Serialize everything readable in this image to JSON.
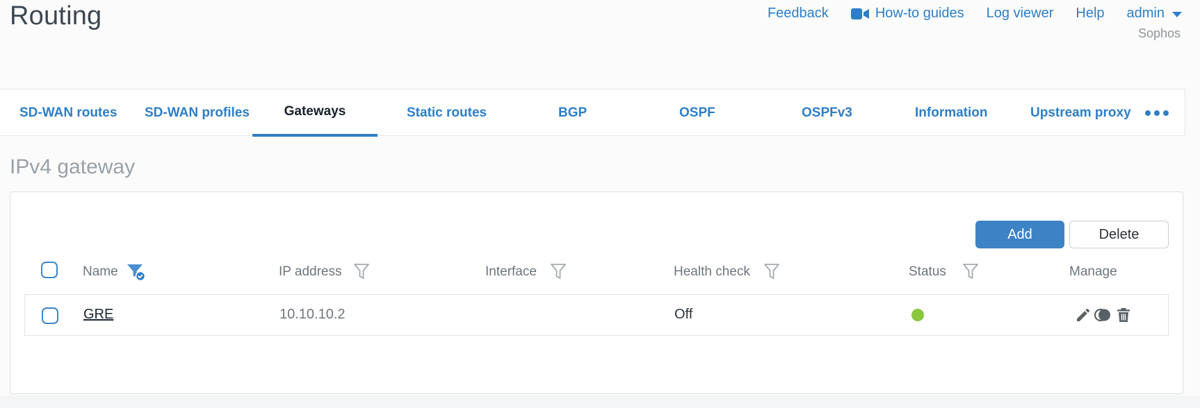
{
  "app": {
    "title": "Routing",
    "brand": "Sophos"
  },
  "header_nav": {
    "feedback": "Feedback",
    "how_to_guides": "How-to guides",
    "log_viewer": "Log viewer",
    "help": "Help",
    "user": "admin"
  },
  "tabs": [
    {
      "label": "SD-WAN routes",
      "active": false
    },
    {
      "label": "SD-WAN profiles",
      "active": false
    },
    {
      "label": "Gateways",
      "active": true
    },
    {
      "label": "Static routes",
      "active": false
    },
    {
      "label": "BGP",
      "active": false
    },
    {
      "label": "OSPF",
      "active": false
    },
    {
      "label": "OSPFv3",
      "active": false
    },
    {
      "label": "Information",
      "active": false
    },
    {
      "label": "Upstream proxy",
      "active": false
    }
  ],
  "section": {
    "title": "IPv4 gateway"
  },
  "toolbar": {
    "add_label": "Add",
    "delete_label": "Delete"
  },
  "table": {
    "columns": [
      {
        "label": "Name",
        "filter": "active-with-check"
      },
      {
        "label": "IP address",
        "filter": "default"
      },
      {
        "label": "Interface",
        "filter": "default"
      },
      {
        "label": "Health check",
        "filter": "default"
      },
      {
        "label": "Status",
        "filter": "default"
      },
      {
        "label": "Manage",
        "filter": "none"
      }
    ],
    "rows": [
      {
        "name": "GRE",
        "ip_address": "10.10.10.2",
        "interface": "",
        "health_check": "Off",
        "status": "up"
      }
    ]
  },
  "icons": {
    "how_to_guides": "video-camera-icon",
    "admin_menu": "caret-down-icon",
    "tab_overflow": "ellipsis-icon",
    "name_column_filter": "funnel-check-icon",
    "column_filter": "funnel-icon",
    "row_edit": "pencil-icon",
    "row_deactivate": "eclipse-circle-icon",
    "row_delete": "trash-icon",
    "status_up": "green-dot"
  },
  "colors": {
    "link_blue": "#2e7ec6",
    "primary_button_blue": "#3e82c6",
    "active_tab_underline": "#2e7ec6",
    "status_up_green": "#8cc63f",
    "filter_active_blue": "#4a90d2",
    "checkbox_border_blue": "#3e86c8"
  }
}
